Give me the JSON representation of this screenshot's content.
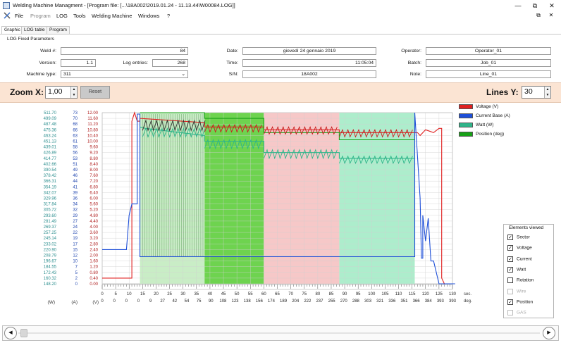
{
  "window": {
    "title": "Welding Machine Managment - [Program file: [...\\18A002\\2019.01.24 - 11.13.44\\W00084.LOG]]",
    "minimize": "—",
    "restore": "⧉",
    "close": "✕",
    "mdi_restore": "⧉",
    "mdi_close": "✕"
  },
  "menu": {
    "items": [
      "File",
      "Program",
      "LOG",
      "Tools",
      "Welding Machine",
      "Windows",
      "?"
    ],
    "disabled": [
      "Program"
    ]
  },
  "tabs": [
    "Graphic",
    "LOG table",
    "Program"
  ],
  "fixed": {
    "panel_title": "LOG Fixed Parameters",
    "weld_label": "Weld #:",
    "weld_value": "84",
    "version_label": "Version:",
    "version_value": "1.1",
    "log_entries_label": "Log entries:",
    "log_entries_value": "268",
    "machine_type_label": "Machine type:",
    "machine_type_value": "311",
    "date_label": "Date:",
    "date_value": "giovedì 24 gennaio 2019",
    "time_label": "Time:",
    "time_value": "11:05:04",
    "sn_label": "S/N:",
    "sn_value": "18A002",
    "operator_label": "Operator:",
    "operator_value": "Operator_01",
    "batch_label": "Batch:",
    "batch_value": "Job_01",
    "note_label": "Note:",
    "note_value": "Line_01"
  },
  "zoom": {
    "zoom_label": "Zoom X:",
    "zoom_value": "1,00",
    "reset_label": "Reset",
    "lines_label": "Lines Y:",
    "lines_value": "30"
  },
  "legend": [
    {
      "name": "Voltage (V)",
      "color": "#e02020"
    },
    {
      "name": "Current Base (A)",
      "color": "#1e4fd8"
    },
    {
      "name": "Watt (W)",
      "color": "#2fb58a"
    },
    {
      "name": "Position (deg)",
      "color": "#16a116"
    }
  ],
  "elements_viewed": {
    "title": "Elements viewed",
    "items": [
      {
        "label": "Sector",
        "checked": true,
        "enabled": true
      },
      {
        "label": "Voltage",
        "checked": true,
        "enabled": true
      },
      {
        "label": "Current",
        "checked": true,
        "enabled": true
      },
      {
        "label": "Watt",
        "checked": true,
        "enabled": true
      },
      {
        "label": "Rotation",
        "checked": false,
        "enabled": true
      },
      {
        "label": "Wire",
        "checked": false,
        "enabled": false
      },
      {
        "label": "Position",
        "checked": true,
        "enabled": true
      },
      {
        "label": "GAS",
        "checked": false,
        "enabled": false
      }
    ]
  },
  "axes": {
    "watt_ticks": [
      "511.70",
      "499.09",
      "487.48",
      "475.36",
      "463.24",
      "451.13",
      "439.01",
      "426.89",
      "414.77",
      "402.66",
      "390.54",
      "378.42",
      "366.31",
      "354.19",
      "342.07",
      "329.96",
      "317.84",
      "305.72",
      "293.60",
      "281.49",
      "269.37",
      "257.25",
      "245.14",
      "233.02",
      "220.90",
      "208.79",
      "196.67",
      "184.55",
      "172.43",
      "160.32",
      "148.20"
    ],
    "amp_ticks": [
      "73",
      "70",
      "68",
      "66",
      "63",
      "61",
      "58",
      "56",
      "53",
      "51",
      "49",
      "46",
      "44",
      "41",
      "39",
      "36",
      "34",
      "32",
      "29",
      "27",
      "24",
      "22",
      "19",
      "17",
      "15",
      "12",
      "10",
      "7",
      "5",
      "2",
      "0"
    ],
    "volt_ticks": [
      "12.00",
      "11.60",
      "11.20",
      "10.80",
      "10.40",
      "10.00",
      "9.60",
      "9.20",
      "8.80",
      "8.40",
      "8.00",
      "7.60",
      "7.20",
      "6.80",
      "6.40",
      "6.00",
      "5.60",
      "5.20",
      "4.80",
      "4.40",
      "4.00",
      "3.60",
      "3.20",
      "2.80",
      "2.40",
      "2.00",
      "1.60",
      "1.20",
      "0.80",
      "0.40",
      "0.00"
    ],
    "watt_unit": "(W)",
    "amp_unit": "(A)",
    "volt_unit": "(V)",
    "sec_ticks": [
      "0",
      "5",
      "10",
      "15",
      "20",
      "25",
      "30",
      "35",
      "40",
      "45",
      "50",
      "55",
      "60",
      "65",
      "70",
      "75",
      "80",
      "85",
      "90",
      "95",
      "100",
      "105",
      "110",
      "115",
      "120",
      "125",
      "130"
    ],
    "deg_ticks": [
      "0",
      "0",
      "0",
      "0",
      "9",
      "27",
      "42",
      "54",
      "75",
      "90",
      "108",
      "123",
      "138",
      "156",
      "174",
      "189",
      "204",
      "222",
      "237",
      "255",
      "270",
      "288",
      "303",
      "321",
      "336",
      "351",
      "366",
      "384",
      "393",
      "393"
    ],
    "sec_unit": "sec.",
    "deg_unit": "deg."
  },
  "chart_data": {
    "type": "line",
    "x_unit": "sec",
    "x_range": [
      0,
      130
    ],
    "sectors": [
      {
        "x0": 14,
        "x1": 38,
        "color": "#c6ecc3"
      },
      {
        "x0": 38,
        "x1": 60,
        "color": "#66d146"
      },
      {
        "x0": 60,
        "x1": 88,
        "color": "#f6c5c5"
      },
      {
        "x0": 88,
        "x1": 116,
        "color": "#a9ecc9"
      }
    ],
    "series": [
      {
        "name": "Voltage (V)",
        "color": "#e02020",
        "points": [
          [
            0,
            0.4
          ],
          [
            11,
            0.4
          ],
          [
            11,
            11.4
          ],
          [
            12,
            12.0
          ],
          [
            13,
            11.4
          ],
          [
            14,
            11.4
          ],
          [
            14,
            11.6
          ],
          [
            38,
            11.3
          ],
          [
            38,
            11.0
          ],
          [
            60,
            11.0
          ],
          [
            60,
            10.8
          ],
          [
            88,
            10.8
          ],
          [
            88,
            10.6
          ],
          [
            116,
            10.6
          ],
          [
            117,
            10.6
          ],
          [
            118,
            10.4
          ],
          [
            120,
            10.8
          ],
          [
            123,
            10.6
          ],
          [
            125,
            10.9
          ],
          [
            126,
            10.9
          ],
          [
            126,
            0.4
          ],
          [
            127,
            0.0
          ]
        ]
      },
      {
        "name": "Current Base (A)",
        "color": "#1e4fd8",
        "points": [
          [
            0,
            2.4
          ],
          [
            9,
            2.4
          ],
          [
            10,
            4.8
          ],
          [
            11,
            5.6
          ],
          [
            13,
            5.6
          ],
          [
            13,
            11.9
          ],
          [
            14,
            11.9
          ],
          [
            14,
            1.9
          ],
          [
            38,
            1.9
          ],
          [
            60,
            1.9
          ],
          [
            88,
            1.9
          ],
          [
            116,
            1.9
          ],
          [
            116,
            12.0
          ],
          [
            118,
            6.0
          ],
          [
            118.5,
            1.8
          ],
          [
            119,
            1.8
          ],
          [
            119,
            4.8
          ],
          [
            120,
            3.0
          ],
          [
            121,
            4.6
          ],
          [
            122,
            1.6
          ],
          [
            123,
            1.6
          ],
          [
            125,
            0.0
          ],
          [
            131,
            0.0
          ]
        ]
      },
      {
        "name": "Watt (W)",
        "color": "#2fb58a",
        "points": [
          [
            14,
            11.0
          ],
          [
            16,
            10.9
          ],
          [
            38,
            10.4
          ],
          [
            38,
            10.0
          ],
          [
            60,
            10.0
          ],
          [
            60,
            9.2
          ],
          [
            88,
            9.2
          ],
          [
            88,
            8.8
          ],
          [
            116,
            8.8
          ]
        ]
      },
      {
        "name": "Position (deg)",
        "color": "#16a116",
        "points": [
          [
            14,
            12.0
          ],
          [
            38,
            12.0
          ],
          [
            38,
            11.6
          ],
          [
            60,
            11.6
          ],
          [
            60,
            10.6
          ],
          [
            88,
            10.6
          ],
          [
            88,
            10.1
          ],
          [
            116,
            10.1
          ]
        ]
      }
    ]
  },
  "scroll": {
    "left_arrow": "◀",
    "right_arrow": "▶"
  }
}
